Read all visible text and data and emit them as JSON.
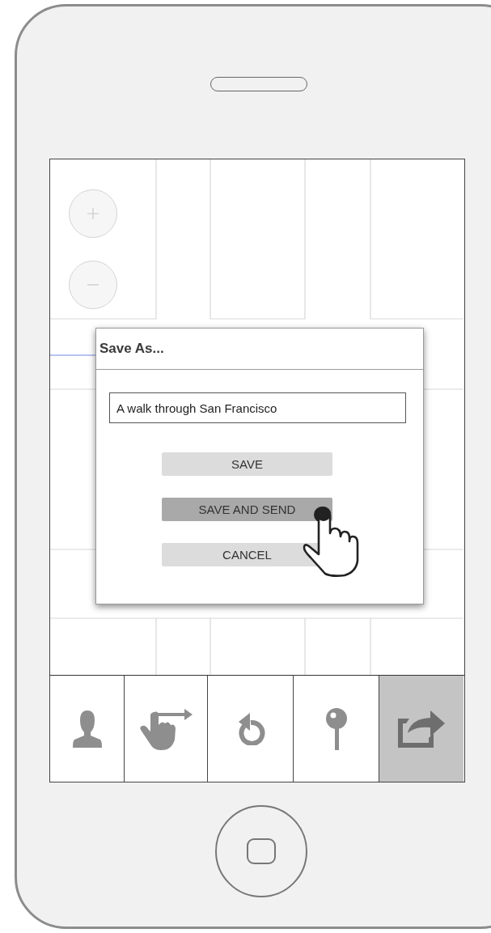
{
  "dialog": {
    "title": "Save As...",
    "field": {
      "value": "A walk through San Francisco"
    },
    "buttons": [
      {
        "label": "SAVE",
        "pressed": false
      },
      {
        "label": "SAVE AND SEND",
        "pressed": true
      },
      {
        "label": "CANCEL",
        "pressed": false
      }
    ]
  },
  "toolbar": {
    "items": [
      {
        "selected": false
      },
      {
        "selected": false
      },
      {
        "selected": false
      },
      {
        "selected": false
      },
      {
        "selected": true
      }
    ]
  }
}
